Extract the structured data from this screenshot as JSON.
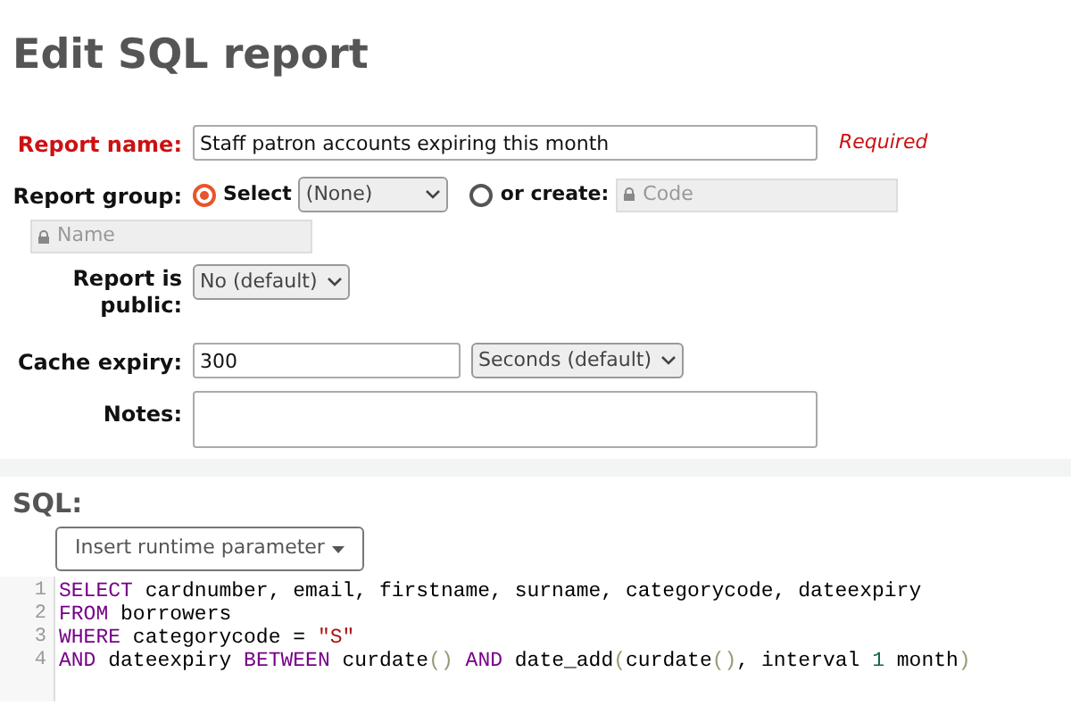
{
  "page_title": "Edit SQL report",
  "report_name": {
    "label": "Report name:",
    "required": true,
    "value": "Staff patron accounts expiring this month",
    "hint": "Required"
  },
  "report_group": {
    "label": "Report group:",
    "options": [
      {
        "label": "Select",
        "selected": true
      },
      {
        "label": "or create:",
        "selected": false
      }
    ],
    "select_value": "(None)",
    "code_placeholder": "Code",
    "name_placeholder": "Name"
  },
  "report_public": {
    "label": "Report is public:",
    "value": "No (default)"
  },
  "cache_expiry": {
    "label": "Cache expiry:",
    "value": "300",
    "unit": "Seconds (default)"
  },
  "notes": {
    "label": "Notes:"
  },
  "sql": {
    "heading": "SQL:",
    "insert_button": "Insert runtime parameter",
    "lines": [
      {
        "number": "1",
        "tokens": [
          {
            "kind": "keyword",
            "text": "SELECT"
          },
          {
            "kind": "plain",
            "text": " cardnumber, email, firstname, surname, categorycode, dateexpiry"
          }
        ]
      },
      {
        "number": "2",
        "tokens": [
          {
            "kind": "keyword",
            "text": "FROM"
          },
          {
            "kind": "plain",
            "text": " borrowers"
          }
        ]
      },
      {
        "number": "3",
        "tokens": [
          {
            "kind": "keyword",
            "text": "WHERE"
          },
          {
            "kind": "plain",
            "text": " categorycode = "
          },
          {
            "kind": "string",
            "text": "\"S\""
          }
        ]
      },
      {
        "number": "4",
        "tokens": [
          {
            "kind": "keyword",
            "text": "AND"
          },
          {
            "kind": "plain",
            "text": " dateexpiry "
          },
          {
            "kind": "keyword",
            "text": "BETWEEN"
          },
          {
            "kind": "plain",
            "text": " curdate"
          },
          {
            "kind": "bracket",
            "text": "()"
          },
          {
            "kind": "keyword",
            "text": " AND"
          },
          {
            "kind": "plain",
            "text": " date_add"
          },
          {
            "kind": "bracket",
            "text": "("
          },
          {
            "kind": "plain",
            "text": "curdate"
          },
          {
            "kind": "bracket",
            "text": "()"
          },
          {
            "kind": "plain",
            "text": ", interval "
          },
          {
            "kind": "number",
            "text": "1"
          },
          {
            "kind": "plain",
            "text": " month"
          },
          {
            "kind": "bracket",
            "text": ")"
          }
        ]
      }
    ]
  }
}
